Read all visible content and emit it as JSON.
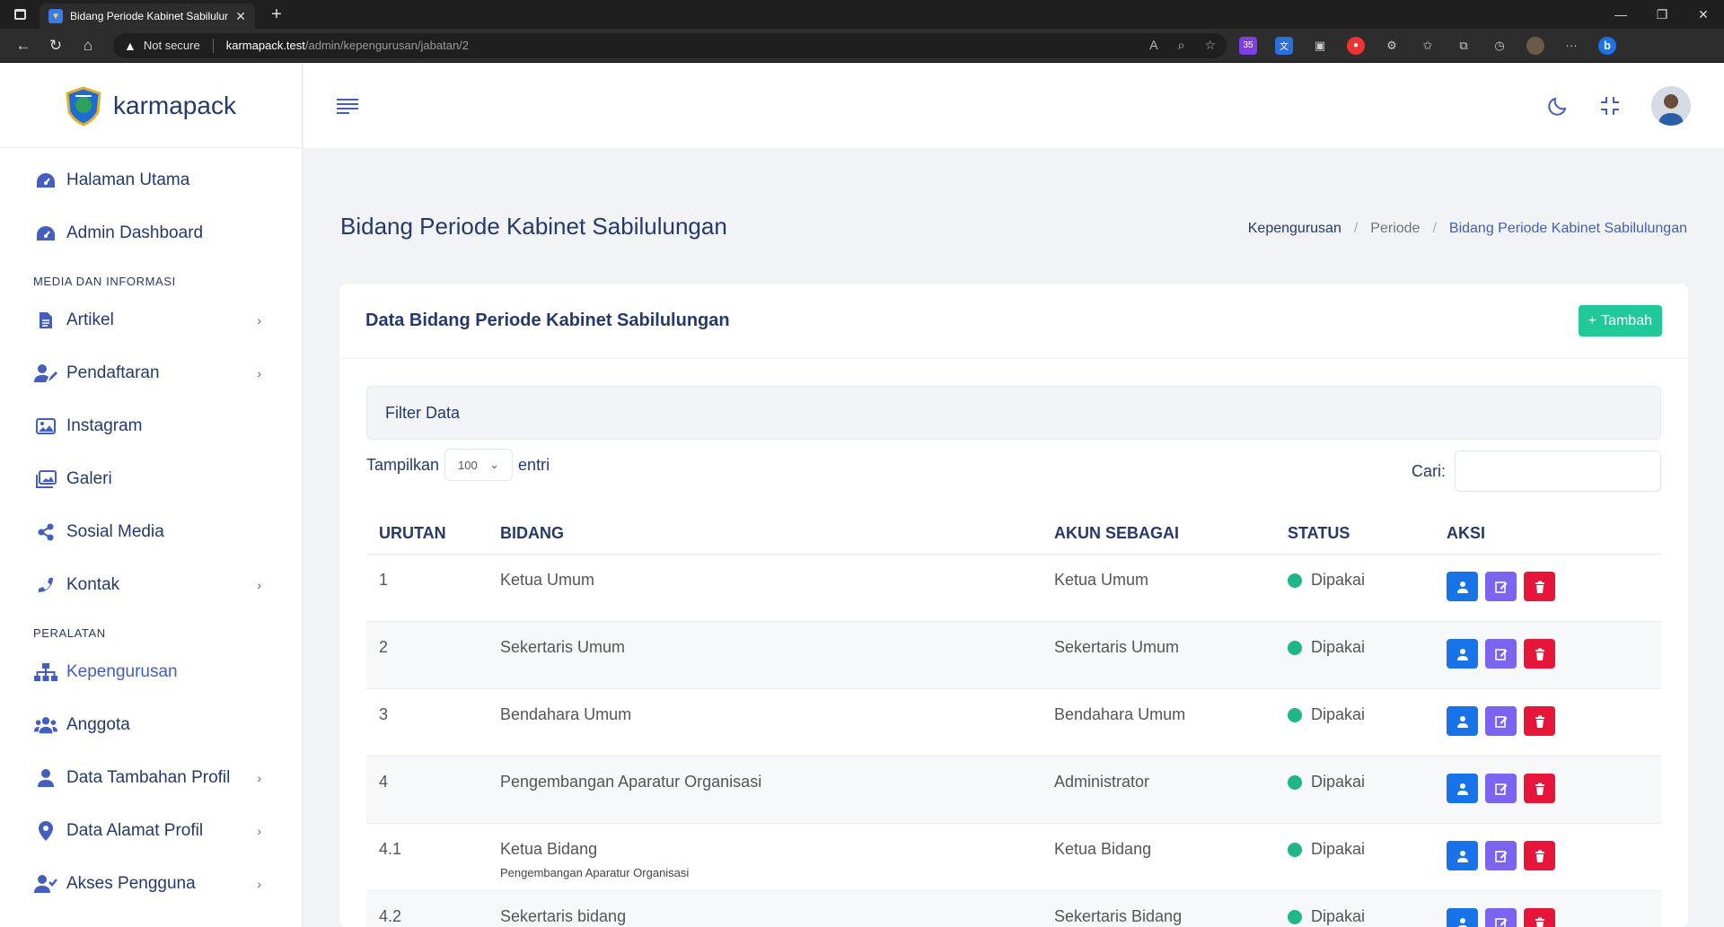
{
  "browser": {
    "tab_title": "Bidang Periode Kabinet Sabilulun",
    "security_label": "Not secure",
    "url_host": "karmapack.test",
    "url_path": "/admin/kepengurusan/jabatan/2",
    "ext_badge": "35"
  },
  "brand": {
    "name": "karmapack"
  },
  "sidebar": {
    "items_top": [
      {
        "label": "Halaman Utama",
        "icon": "dashboard-icon"
      },
      {
        "label": "Admin Dashboard",
        "icon": "dashboard-icon"
      }
    ],
    "section_media": "MEDIA DAN INFORMASI",
    "items_media": [
      {
        "label": "Artikel",
        "icon": "file-icon",
        "has_children": true
      },
      {
        "label": "Pendaftaran",
        "icon": "user-edit-icon",
        "has_children": true
      },
      {
        "label": "Instagram",
        "icon": "image-icon",
        "has_children": false
      },
      {
        "label": "Galeri",
        "icon": "images-icon",
        "has_children": false
      },
      {
        "label": "Sosial Media",
        "icon": "share-icon",
        "has_children": false
      },
      {
        "label": "Kontak",
        "icon": "phone-icon",
        "has_children": true
      }
    ],
    "section_tools": "PERALATAN",
    "items_tools": [
      {
        "label": "Kepengurusan",
        "icon": "sitemap-icon",
        "active": true
      },
      {
        "label": "Anggota",
        "icon": "users-icon"
      },
      {
        "label": "Data Tambahan Profil",
        "icon": "user-icon",
        "has_children": true
      },
      {
        "label": "Data Alamat Profil",
        "icon": "map-pin-icon",
        "has_children": true
      },
      {
        "label": "Akses Pengguna",
        "icon": "user-check-icon",
        "has_children": true
      }
    ]
  },
  "page": {
    "title": "Bidang Periode Kabinet Sabilulungan",
    "breadcrumb": [
      "Kepengurusan",
      "Periode",
      "Bidang Periode Kabinet Sabilulungan"
    ]
  },
  "card": {
    "title": "Data Bidang Periode Kabinet Sabilulungan",
    "add_label": "Tambah",
    "filter_label": "Filter Data",
    "length_prefix": "Tampilkan",
    "length_value": "100",
    "length_suffix": "entri",
    "search_label": "Cari:",
    "search_value": ""
  },
  "table": {
    "headers": [
      "URUTAN",
      "BIDANG",
      "AKUN SEBAGAI",
      "STATUS",
      "AKSI"
    ],
    "rows": [
      {
        "no": "1",
        "bidang": "Ketua Umum",
        "sub": "",
        "akun": "Ketua Umum",
        "status": "Dipakai"
      },
      {
        "no": "2",
        "bidang": "Sekertaris Umum",
        "sub": "",
        "akun": "Sekertaris Umum",
        "status": "Dipakai"
      },
      {
        "no": "3",
        "bidang": "Bendahara Umum",
        "sub": "",
        "akun": "Bendahara Umum",
        "status": "Dipakai"
      },
      {
        "no": "4",
        "bidang": "Pengembangan Aparatur Organisasi",
        "sub": "",
        "akun": "Administrator",
        "status": "Dipakai"
      },
      {
        "no": "4.1",
        "bidang": "Ketua Bidang",
        "sub": "Pengembangan Aparatur Organisasi",
        "akun": "Ketua Bidang",
        "status": "Dipakai"
      },
      {
        "no": "4.2",
        "bidang": "Sekertaris bidang",
        "sub": "",
        "akun": "Sekertaris Bidang",
        "status": "Dipakai"
      }
    ]
  },
  "colors": {
    "primary": "#435ebe",
    "success": "#20c997",
    "btn_user": "#1873e8",
    "btn_edit": "#7b64f0",
    "btn_delete": "#e8153a"
  }
}
